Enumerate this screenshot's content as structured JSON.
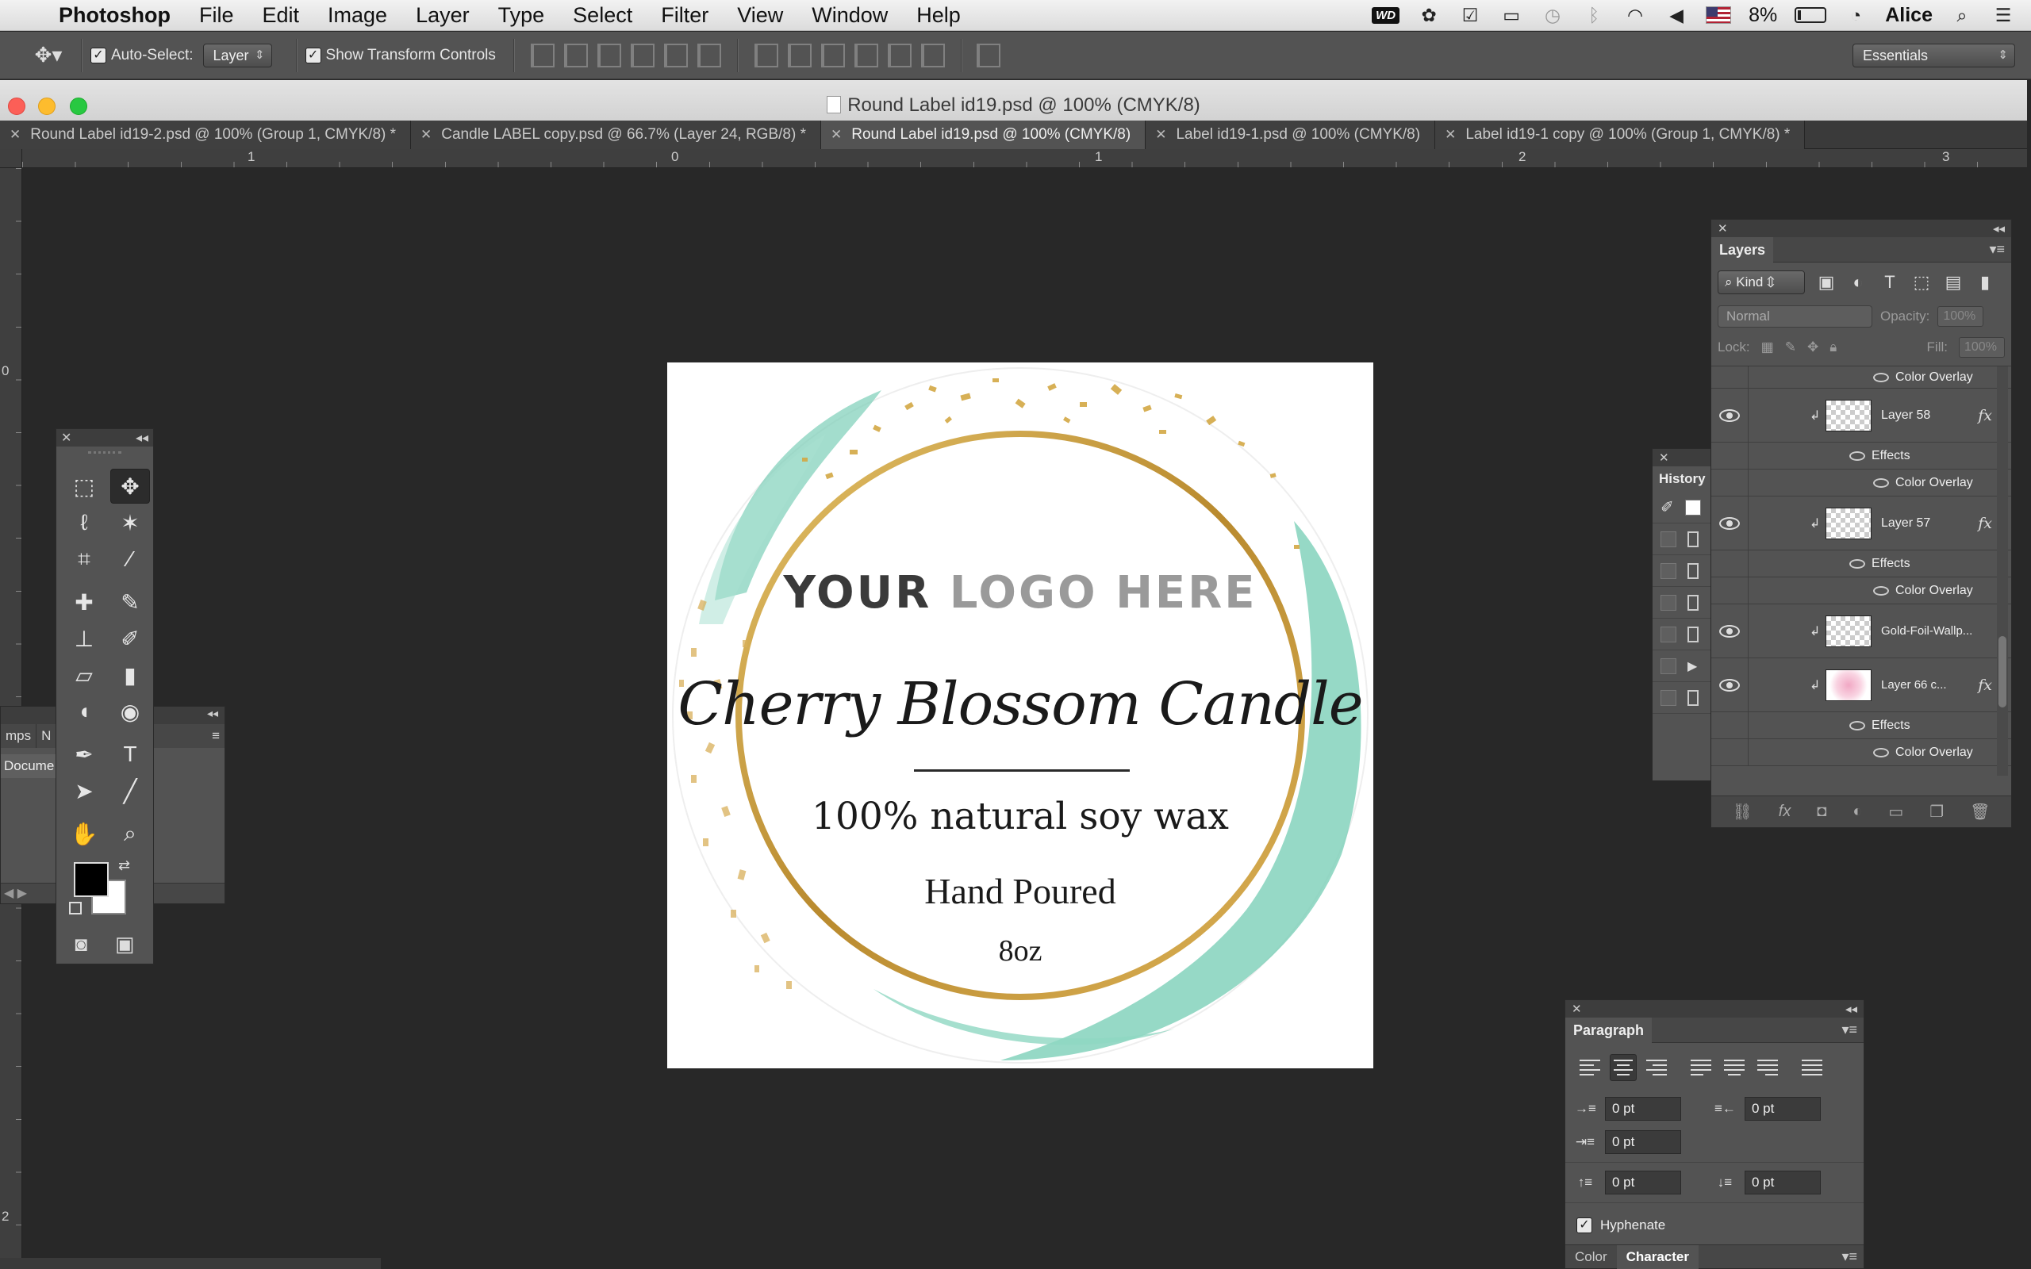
{
  "menubar": {
    "app_name": "Photoshop",
    "menus": [
      "File",
      "Edit",
      "Image",
      "Layer",
      "Type",
      "Select",
      "Filter",
      "View",
      "Window",
      "Help"
    ],
    "wd_badge": "WD",
    "battery": "8%",
    "user": "Alice"
  },
  "options": {
    "auto_select_label": "Auto-Select:",
    "auto_select_value": "Layer",
    "show_transform_label": "Show Transform Controls",
    "workspace": "Essentials"
  },
  "document": {
    "title": "Round Label id19.psd @ 100% (CMYK/8)"
  },
  "tabs": [
    {
      "label": "Round Label id19-2.psd @ 100% (Group 1, CMYK/8) *"
    },
    {
      "label": "Candle LABEL copy.psd @ 66.7% (Layer 24, RGB/8) *"
    },
    {
      "label": "Round Label id19.psd @ 100% (CMYK/8)"
    },
    {
      "label": "Label id19-1.psd @ 100% (CMYK/8)"
    },
    {
      "label": "Label id19-1 copy @ 100% (Group 1, CMYK/8) *"
    }
  ],
  "rulers": {
    "top_ticks": [
      "1",
      "0",
      "1",
      "2",
      "3"
    ],
    "left_ticks": [
      "0",
      "2"
    ]
  },
  "label": {
    "logo_dark": "YOUR",
    "logo_light": "LOGO HERE",
    "script_title": "Cherry Blossom Candle",
    "line1": "100% natural soy wax",
    "line2": "Hand Poured",
    "line3": "8oz",
    "colors": {
      "gold": "#c9a040",
      "mint": "#7ccfb8",
      "logo_dark": "#3a3a3a",
      "logo_light": "#9a9a9a"
    }
  },
  "left_panel": {
    "tab1": "mps",
    "tab2": "N",
    "row_label": "Docume"
  },
  "layers_panel": {
    "title": "Layers",
    "kind_label": "Kind",
    "blend_mode": "Normal",
    "opacity_label": "Opacity:",
    "opacity_value": "100%",
    "lock_label": "Lock:",
    "fill_label": "Fill:",
    "fill_value": "100%",
    "top_effect": "Color Overlay",
    "layers": [
      {
        "name": "Layer 58",
        "effects_label": "Effects",
        "effect": "Color Overlay"
      },
      {
        "name": "Layer 57",
        "effects_label": "Effects",
        "effect": "Color Overlay"
      },
      {
        "name": "Gold-Foil-Wallp..."
      },
      {
        "name": "Layer 66 c...",
        "effects_label": "Effects",
        "effect": "Color Overlay"
      }
    ]
  },
  "history_panel": {
    "title": "History"
  },
  "paragraph_panel": {
    "title": "Paragraph",
    "indent_left": "0 pt",
    "indent_right": "0 pt",
    "indent_first": "0 pt",
    "space_before": "0 pt",
    "space_after": "0 pt",
    "hyphenate_label": "Hyphenate",
    "bottom_tabs": [
      "Color",
      "Character"
    ]
  }
}
